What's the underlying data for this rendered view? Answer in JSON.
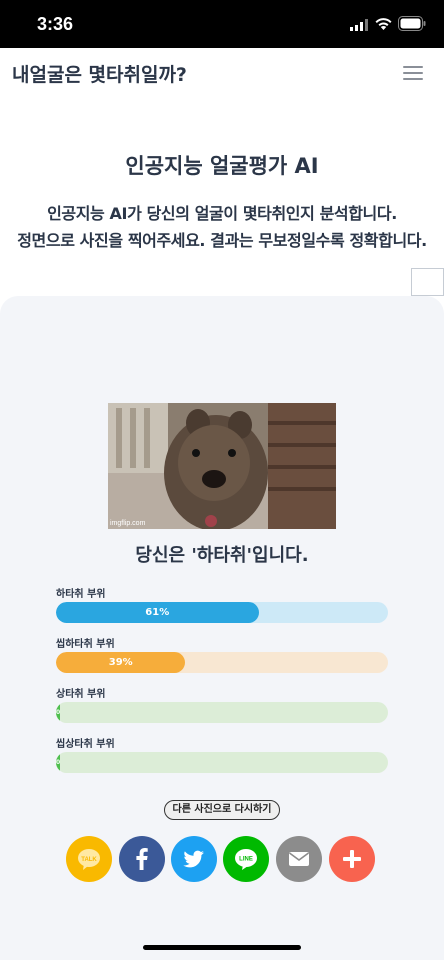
{
  "status_bar": {
    "time": "3:36"
  },
  "header": {
    "title": "내얼굴은 몇타취일까?"
  },
  "intro": {
    "title": "인공지능 얼굴평가 AI",
    "line1": "인공지능 AI가 당신의 얼굴이 몇타취인지 분석합니다.",
    "line2": "정면으로 사진을 찍어주세요. 결과는 무보정일수록 정확합니다."
  },
  "result": {
    "watermark": "imgflip.com",
    "text": "당신은 '하타취'입니다.",
    "bars": [
      {
        "label": "하타취 부위",
        "percent": 61,
        "value_text": "61%",
        "fill_color": "#2aa6e0",
        "track_color": "#cde9f7"
      },
      {
        "label": "씹하타취 부위",
        "percent": 39,
        "value_text": "39%",
        "fill_color": "#f6ad3b",
        "track_color": "#f8e7d2"
      },
      {
        "label": "상타취 부위",
        "percent": 0,
        "value_text": "0%",
        "fill_color": "#4fbf4f",
        "track_color": "#dcedd7"
      },
      {
        "label": "씹상타취 부위",
        "percent": 0,
        "value_text": "0%",
        "fill_color": "#4fbf4f",
        "track_color": "#dcedd7"
      }
    ],
    "retry_label": "다른 사진으로 다시하기"
  },
  "share": {
    "kakao_text": "TALK",
    "line_text": "LINE",
    "buttons": [
      {
        "name": "kakaotalk",
        "color": "#f9b900"
      },
      {
        "name": "facebook",
        "color": "#3b5998"
      },
      {
        "name": "twitter",
        "color": "#1da1f2"
      },
      {
        "name": "line",
        "color": "#00b900"
      },
      {
        "name": "email",
        "color": "#8c8c8c"
      },
      {
        "name": "more",
        "color": "#f8634f"
      }
    ]
  }
}
